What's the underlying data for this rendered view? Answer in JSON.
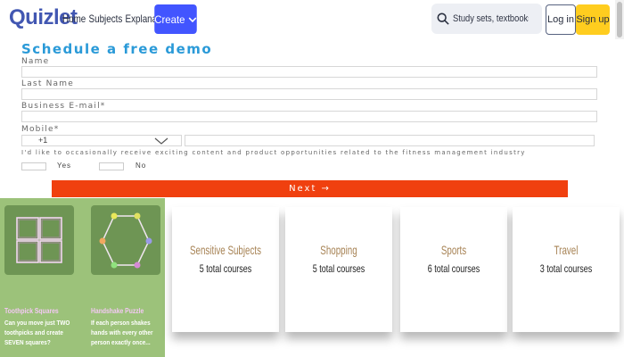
{
  "header": {
    "logo": "Quizlet",
    "nav": [
      "Home",
      "Subjects",
      "Explanations"
    ],
    "create_label": "Create",
    "search_placeholder": "Study sets, textbooks, ...",
    "login_label": "Log in",
    "signup_label": "Sign up"
  },
  "form": {
    "title": "Schedule a free demo",
    "labels": [
      "Name",
      "Last Name",
      "Business E-mail*",
      "Mobile*"
    ],
    "country_code": "+1",
    "consent_text": "I'd like to occasionally receive exciting content and product opportunities related to the fitness management industry",
    "yes_label": "Yes",
    "no_label": "No",
    "next_label": "Next →"
  },
  "puzzles": [
    {
      "title": "Toothpick Squares",
      "desc": "Can you move just TWO toothpicks and create SEVEN squares?"
    },
    {
      "title": "Handshake Puzzle",
      "desc": "If each person shakes hands with every other person exactly once..."
    }
  ],
  "courses": [
    {
      "title": "Sensitive Subjects",
      "count": "5 total courses"
    },
    {
      "title": "Shopping",
      "count": "5 total courses"
    },
    {
      "title": "Sports",
      "count": "6 total courses"
    },
    {
      "title": "Travel",
      "count": "3 total courses"
    }
  ],
  "colors": {
    "brand": "#4255ff",
    "signup": "#ffcd1f",
    "next_button": "#f0400f",
    "form_title": "#2a9ad8",
    "puzzle_panel": "#9cc27a",
    "course_title": "#a78355"
  },
  "icons": [
    "chevron-down-icon",
    "search-icon",
    "arrow-right-icon",
    "toothpick-grid-icon",
    "hexagon-handshake-icon"
  ]
}
